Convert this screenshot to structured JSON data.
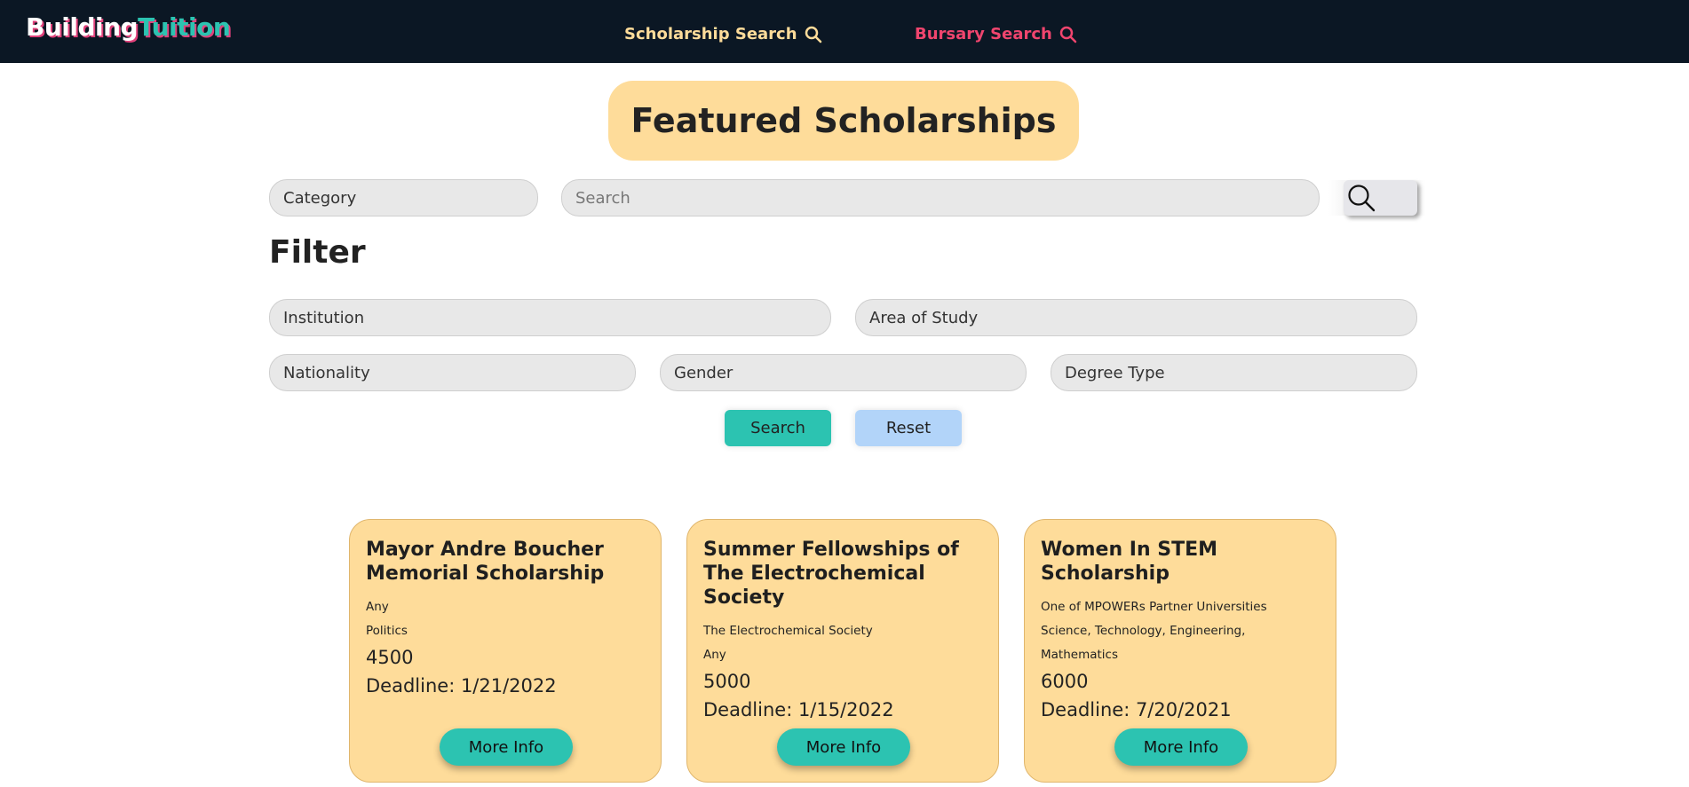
{
  "nav": {
    "logo_part1": "Building",
    "logo_part2": "Tuition",
    "scholarship_search": "Scholarship Search",
    "bursary_search": "Bursary Search"
  },
  "heading": "Featured Scholarships",
  "search": {
    "category": "Category",
    "placeholder": "Search"
  },
  "filter": {
    "title": "Filter",
    "institution": "Institution",
    "area_of_study": "Area of Study",
    "nationality": "Nationality",
    "gender": "Gender",
    "degree_type": "Degree Type",
    "search_label": "Search",
    "reset_label": "Reset"
  },
  "cards": [
    {
      "title": "Mayor Andre Boucher Memorial Scholarship",
      "line1": "Any",
      "line2": "Politics",
      "amount": "4500",
      "deadline": "Deadline: 1/21/2022",
      "button": "More Info"
    },
    {
      "title": "Summer Fellowships of The Electrochemical Society",
      "line1": "The Electrochemical Society",
      "line2": "Any",
      "amount": "5000",
      "deadline": "Deadline: 1/15/2022",
      "button": "More Info"
    },
    {
      "title": "Women In STEM Scholarship",
      "line1": "One of MPOWERs Partner Universities",
      "line2": "Science, Technology, Engineering, Mathematics",
      "amount": "6000",
      "deadline": "Deadline: 7/20/2021",
      "button": "More Info"
    }
  ],
  "colors": {
    "navbar": "#0b1724",
    "accent_teal": "#2cc3b1",
    "accent_pink": "#f0456e",
    "card_bg": "#fedc9a",
    "reset_bg": "#b2d4f9"
  }
}
